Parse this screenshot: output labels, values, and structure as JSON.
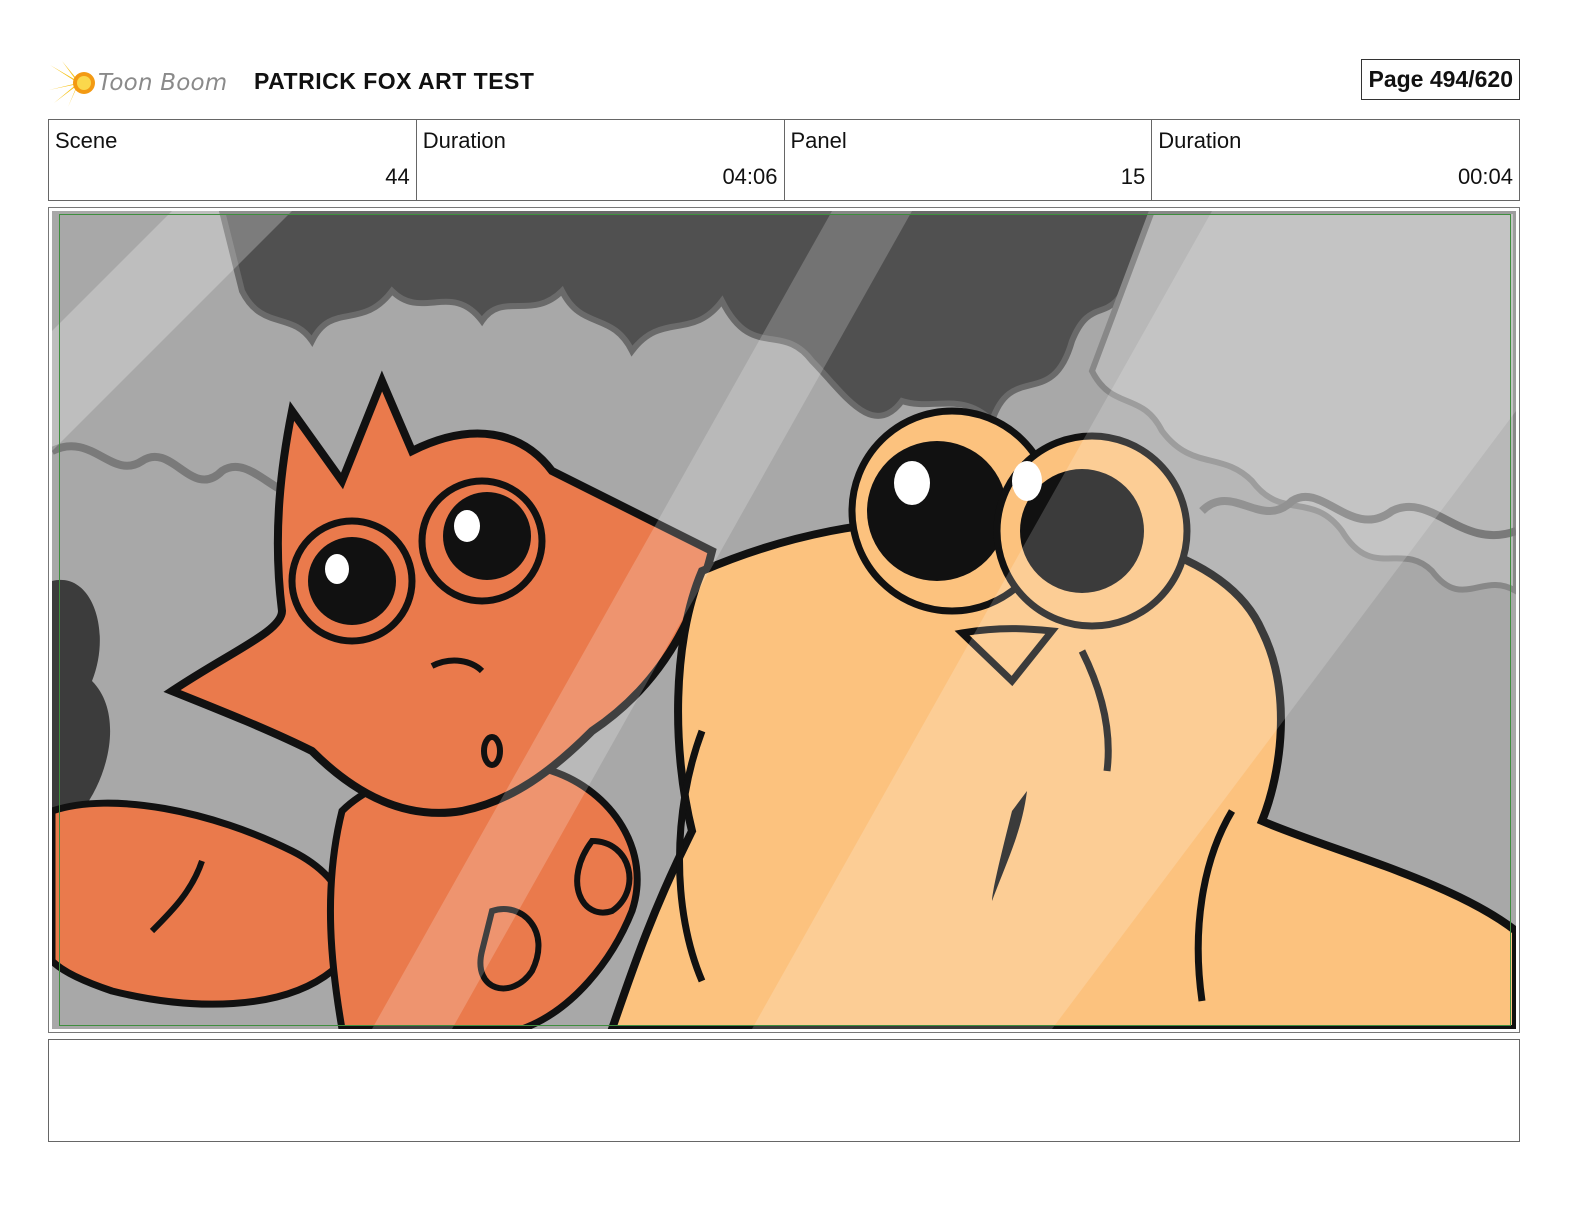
{
  "header": {
    "logo_text": "Toon Boom",
    "title": "PATRICK FOX ART TEST",
    "page_label": "Page 494/620"
  },
  "info": [
    {
      "label": "Scene",
      "value": "44"
    },
    {
      "label": "Duration",
      "value": "04:06"
    },
    {
      "label": "Panel",
      "value": "15"
    },
    {
      "label": "Duration",
      "value": "00:04"
    }
  ],
  "panel": {
    "description_icon": "storyboard-panel-fox-and-frog",
    "colors": {
      "fox": "#ea7a4c",
      "frog": "#fcc27e",
      "background": "#a6a6a6",
      "shadow": "#4a4a4a",
      "safe_frame": "#3e8e3e"
    }
  },
  "notes": {
    "text": ""
  }
}
